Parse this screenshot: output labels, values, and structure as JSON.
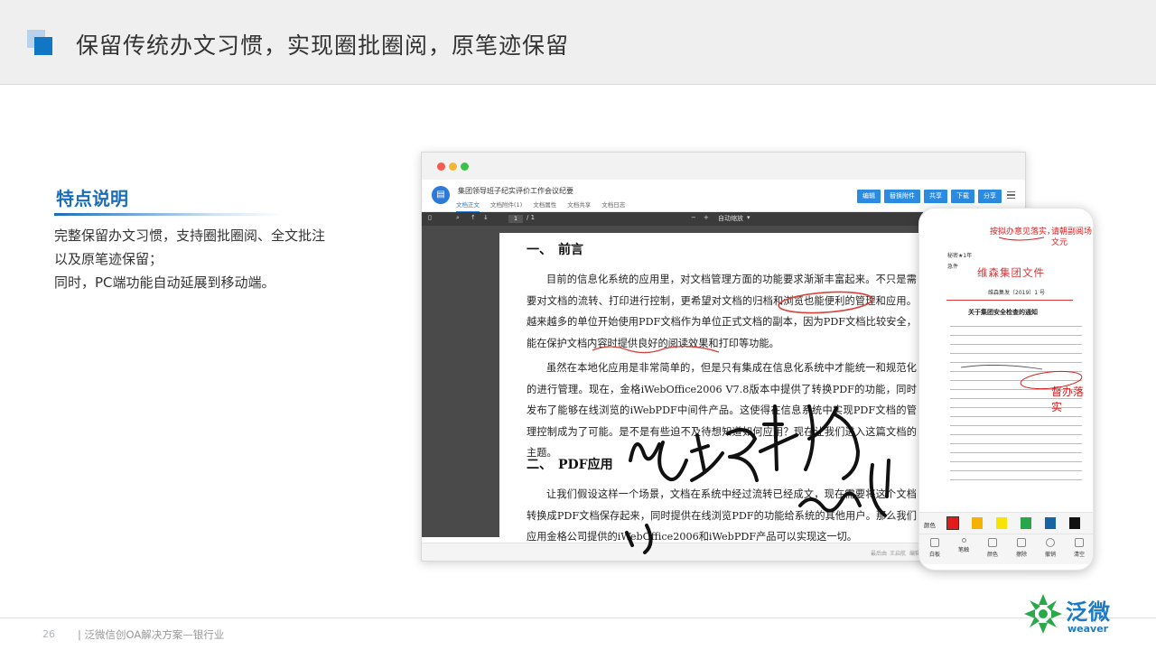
{
  "header": {
    "title": "保留传统办文习惯，实现圈批圈阅，原笔迹保留"
  },
  "feature": {
    "title": "特点说明",
    "lines": [
      "完整保留办文习惯，支持圈批圈阅、全文批注",
      "以及原笔迹保留；",
      "同时，PC端功能自动延展到移动端。"
    ]
  },
  "app": {
    "doc_title": "集团领导班子纪实评价工作会议纪要",
    "tabs": [
      "文档正文",
      "文档附件(1)",
      "文档属性",
      "文档共享",
      "文档日志"
    ],
    "buttons": [
      "编辑",
      "替换附件",
      "共享",
      "下载",
      "分享"
    ],
    "pdf": {
      "page": "1",
      "total": "/ 1",
      "zoom": "自动缩放",
      "minus": "−",
      "plus": "+"
    },
    "status": [
      "最后由",
      "王启航",
      "编辑"
    ]
  },
  "doc": {
    "h1": "一、　前言",
    "p1": "目前的信息化系统的应用里，对文档管理方面的功能要求渐渐丰富起来。不只是需要对文档的流转、打印进行控制，更希望对文档的归档和浏览也能便利的管理和应用。越来越多的单位开始使用PDF文档作为单位正式文档的副本，因为PDF文档比较安全，能在保护文档内容时提供良好的阅读效果和打印等功能。",
    "p2": "虽然在本地化应用是非常简单的，但是只有集成在信息化系统中才能统一和规范化的进行管理。现在，金格iWebOffice2006 V7.8版本中提供了转换PDF的功能，同时发布了能够在线浏览的iWebPDF中间件产品。这使得在信息系统中实现PDF文档的管理控制成为了可能。是不是有些迫不及待想知道如何应用？现在让我们进入这篇文档的主题。",
    "h2": "二、　PDF应用",
    "p3": "让我们假设这样一个场景，文档在系统中经过流转已经成文，现在需要将这个文档转换成PDF文档保存起来，同时提供在线浏览PDF的功能给系统的其他用户。那么我们应用金格公司提供的iWebOffice2006和iWebPDF产品可以实现这一切。"
  },
  "phone": {
    "note1": "按拟办意见落实，",
    "note2": "请朝副阅场文元",
    "secret": "秘密★1年",
    "urgency": "急件",
    "org_title": "维森集团文件",
    "doc_no": "维森集发〔2019〕1 号",
    "notice": "关于集团安全检查的通知",
    "note3": "督办落实",
    "palette_label": "颜色",
    "colors": [
      "#e41b1b",
      "#f5b100",
      "#f7e400",
      "#27a74a",
      "#1663a6",
      "#111111"
    ],
    "tools": [
      "白板",
      "笔触",
      "颜色",
      "擦除",
      "撤销",
      "清空"
    ]
  },
  "footer": {
    "page": "26",
    "text": "| 泛微信创OA解决方案—银行业"
  },
  "logo": {
    "cn": "泛微",
    "en": "weaver"
  }
}
